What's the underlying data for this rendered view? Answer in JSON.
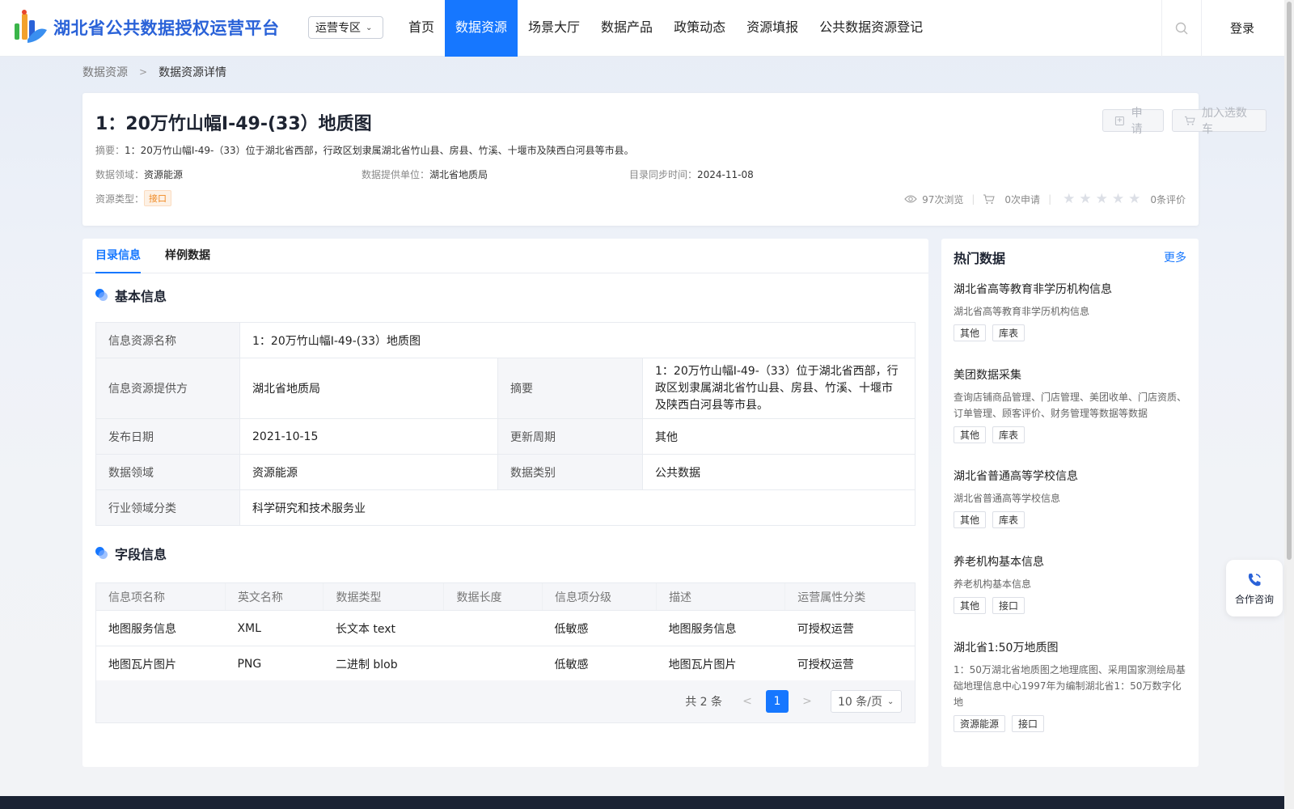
{
  "header": {
    "logo_text": "湖北省公共数据授权运营平台",
    "region_select": "运营专区",
    "nav": [
      {
        "label": "首页",
        "active": false
      },
      {
        "label": "数据资源",
        "active": true
      },
      {
        "label": "场景大厅",
        "active": false
      },
      {
        "label": "数据产品",
        "active": false
      },
      {
        "label": "政策动态",
        "active": false
      },
      {
        "label": "资源填报",
        "active": false
      },
      {
        "label": "公共数据资源登记",
        "active": false
      }
    ],
    "login": "登录",
    "accent": "#1677ff"
  },
  "breadcrumb": {
    "parent": "数据资源",
    "current": "数据资源详情"
  },
  "detail": {
    "title": "1：20万竹山幅I-49-(33）地质图",
    "apply_label": "申请",
    "cart_label": "加入选数车",
    "summary_label": "摘要：",
    "summary": "1：20万竹山幅I-49-（33）位于湖北省西部，行政区划隶属湖北省竹山县、房县、竹溪、十堰市及陕西白河县等市县。",
    "domain_label": "数据领域：",
    "domain": "资源能源",
    "provider_label": "数据提供单位：",
    "provider": "湖北省地质局",
    "sync_label": "目录同步时间：",
    "sync_time": "2024-11-08",
    "type_label": "资源类型：",
    "type": "接口",
    "views": "97次浏览",
    "applies": "0次申请",
    "rating": 0,
    "reviews": "0条评价"
  },
  "tabs": [
    {
      "label": "目录信息",
      "active": true
    },
    {
      "label": "样例数据",
      "active": false
    }
  ],
  "basic": {
    "title": "基本信息",
    "name_label": "信息资源名称",
    "name": "1：20万竹山幅I-49-(33）地质图",
    "provider_label": "信息资源提供方",
    "provider": "湖北省地质局",
    "summary_label": "摘要",
    "summary": "1：20万竹山幅I-49-（33）位于湖北省西部，行政区划隶属湖北省竹山县、房县、竹溪、十堰市及陕西白河县等市县。",
    "date_label": "发布日期",
    "date": "2021-10-15",
    "cycle_label": "更新周期",
    "cycle": "其他",
    "domain_label": "数据领域",
    "domain": "资源能源",
    "category_label": "数据类别",
    "category": "公共数据",
    "industry_label": "行业领域分类",
    "industry": "科学研究和技术服务业"
  },
  "fields": {
    "title": "字段信息",
    "columns": [
      "信息项名称",
      "英文名称",
      "数据类型",
      "数据长度",
      "信息项分级",
      "描述",
      "运营属性分类"
    ],
    "rows": [
      [
        "地图服务信息",
        "XML",
        "长文本 text",
        "",
        "低敏感",
        "地图服务信息",
        "可授权运营"
      ],
      [
        "地图瓦片图片",
        "PNG",
        "二进制 blob",
        "",
        "低敏感",
        "地图瓦片图片",
        "可授权运营"
      ]
    ],
    "total": "共 2 条",
    "page": "1",
    "page_size": "10 条/页"
  },
  "hot": {
    "title": "热门数据",
    "more": "更多",
    "items": [
      {
        "name": "湖北省高等教育非学历机构信息",
        "desc": "湖北省高等教育非学历机构信息",
        "tags": [
          "其他",
          "库表"
        ]
      },
      {
        "name": "美团数据采集",
        "desc": "查询店铺商品管理、门店管理、美团收单、门店资质、订单管理、顾客评价、财务管理等数据等数据",
        "tags": [
          "其他",
          "库表"
        ]
      },
      {
        "name": "湖北省普通高等学校信息",
        "desc": "湖北省普通高等学校信息",
        "tags": [
          "其他",
          "库表"
        ]
      },
      {
        "name": "养老机构基本信息",
        "desc": "养老机构基本信息",
        "tags": [
          "其他",
          "接口"
        ]
      },
      {
        "name": "湖北省1:50万地质图",
        "desc": "1：50万湖北省地质图之地理底图、采用国家测绘局基础地理信息中心1997年为编制湖北省1：50万数字化地",
        "tags": [
          "资源能源",
          "接口"
        ]
      }
    ]
  },
  "consult": "合作咨询"
}
